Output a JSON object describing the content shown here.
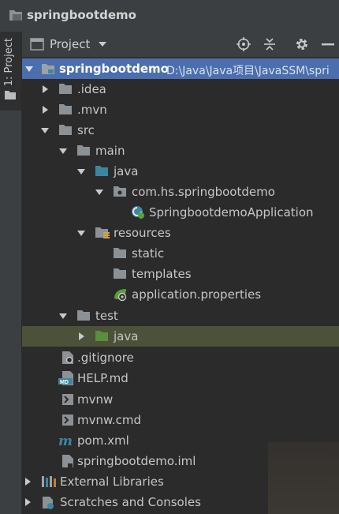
{
  "title": "springbootdemo",
  "sidebar": {
    "tab_label": "1: Project"
  },
  "toolbar": {
    "view_label": "Project"
  },
  "tree": {
    "root_label": "springbootdemo",
    "root_path": "D:\\Java\\Java项目\\JavaSSM\\spri",
    "idea": ".idea",
    "mvn": ".mvn",
    "src": "src",
    "main": "main",
    "java_main": "java",
    "package": "com.hs.springbootdemo",
    "app_class": "SpringbootdemoApplication",
    "resources": "resources",
    "static": "static",
    "templates": "templates",
    "app_props": "application.properties",
    "test": "test",
    "java_test": "java",
    "gitignore": ".gitignore",
    "help": "HELP.md",
    "mvnw": "mvnw",
    "mvnw_cmd": "mvnw.cmd",
    "pom": "pom.xml",
    "iml": "springbootdemo.iml",
    "ext_libs": "External Libraries",
    "scratches": "Scratches and Consoles"
  },
  "colors": {
    "selection": "#4b6eaf",
    "highlight": "#4b5239",
    "folder": "#8c9196",
    "source_folder": "#3e86a0",
    "test_folder": "#5a8f3c"
  },
  "icons": [
    "folder-icon",
    "source-folder-icon",
    "package-icon",
    "spring-boot-class-icon",
    "resources-folder-icon",
    "spring-leaf-icon",
    "markdown-icon",
    "maven-icon",
    "library-icon",
    "scratch-icon"
  ]
}
